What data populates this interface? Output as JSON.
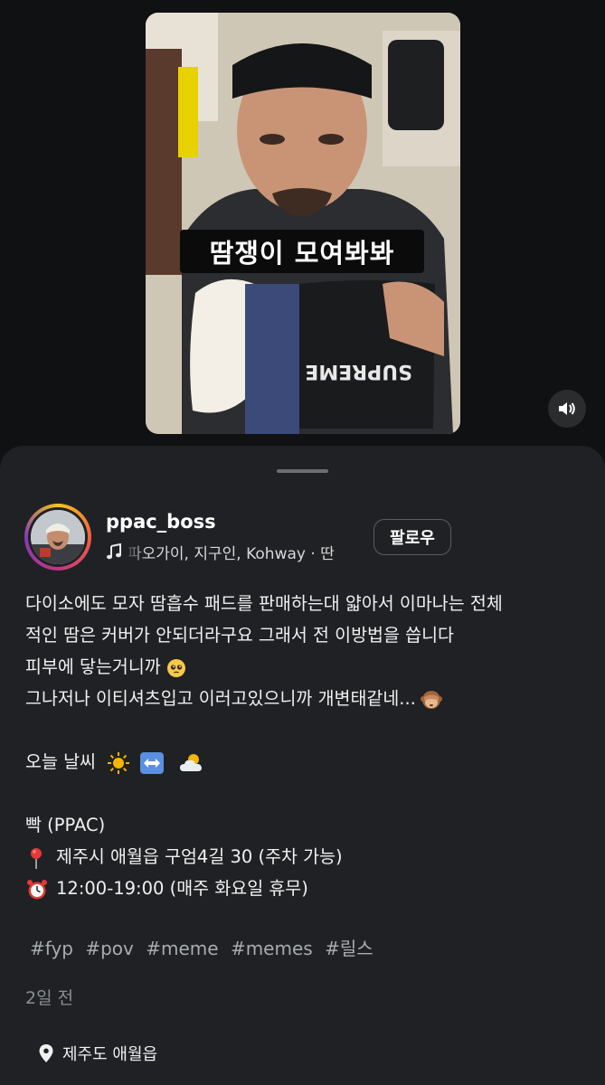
{
  "video": {
    "caption": "땀쟁이 모여봐봐",
    "sound_icon": "speaker-icon"
  },
  "post": {
    "username": "ppac_boss",
    "music_icon": "music-note-icon",
    "music_text": "파오가이, 지구인, Kohway · 딴",
    "follow_label": "팔로우",
    "description_lines": [
      "다이소에도 모자 땀흡수 패드를 판매하는대 얇아서 이마나는 전체",
      "적인 땀은 커버가 안되더라구요 그래서 전 이방법을 씁니다",
      "피부에 닿는거니까",
      "그나저나 이티셔츠입고 이러고있으니까 개변태같네...",
      "",
      "오늘 날씨",
      "",
      "빡 (PPAC)",
      "제주시 애월읍 구엄4길 30 (주차 가능)",
      "12:00-19:00 (매주 화요일 휴무)"
    ],
    "hashtags": [
      "#fyp",
      "#pov",
      "#meme",
      "#memes",
      "#릴스"
    ],
    "time_ago": "2일 전",
    "location": "제주도 애월읍",
    "location_icon": "location-pin-icon"
  }
}
